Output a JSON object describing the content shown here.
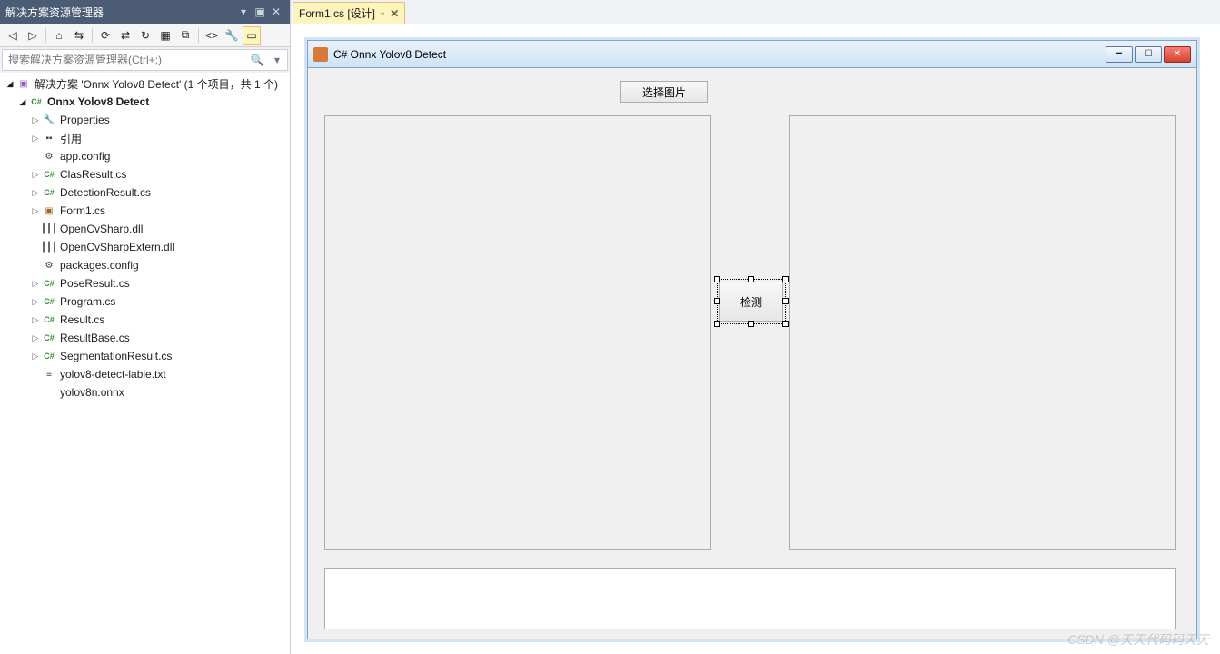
{
  "panel": {
    "title": "解决方案资源管理器",
    "search_placeholder": "搜索解决方案资源管理器(Ctrl+;)"
  },
  "tree": {
    "solution": "解决方案 'Onnx Yolov8 Detect' (1 个项目，共 1 个)",
    "project": "Onnx Yolov8 Detect",
    "items": {
      "properties": "Properties",
      "references": "引用",
      "appconfig": "app.config",
      "clasresult": "ClasResult.cs",
      "detectionresult": "DetectionResult.cs",
      "form1": "Form1.cs",
      "opencvsharp": "OpenCvSharp.dll",
      "opencvsharpextern": "OpenCvSharpExtern.dll",
      "packagesconfig": "packages.config",
      "poseresult": "PoseResult.cs",
      "program": "Program.cs",
      "result": "Result.cs",
      "resultbase": "ResultBase.cs",
      "segmentationresult": "SegmentationResult.cs",
      "labeltxt": "yolov8-detect-lable.txt",
      "onnx": "yolov8n.onnx"
    }
  },
  "tab": {
    "label": "Form1.cs [设计]"
  },
  "form": {
    "title": "C# Onnx Yolov8 Detect",
    "btn_select": "选择图片",
    "btn_detect": "检测"
  },
  "watermark": "CSDN @天天代码码天天"
}
